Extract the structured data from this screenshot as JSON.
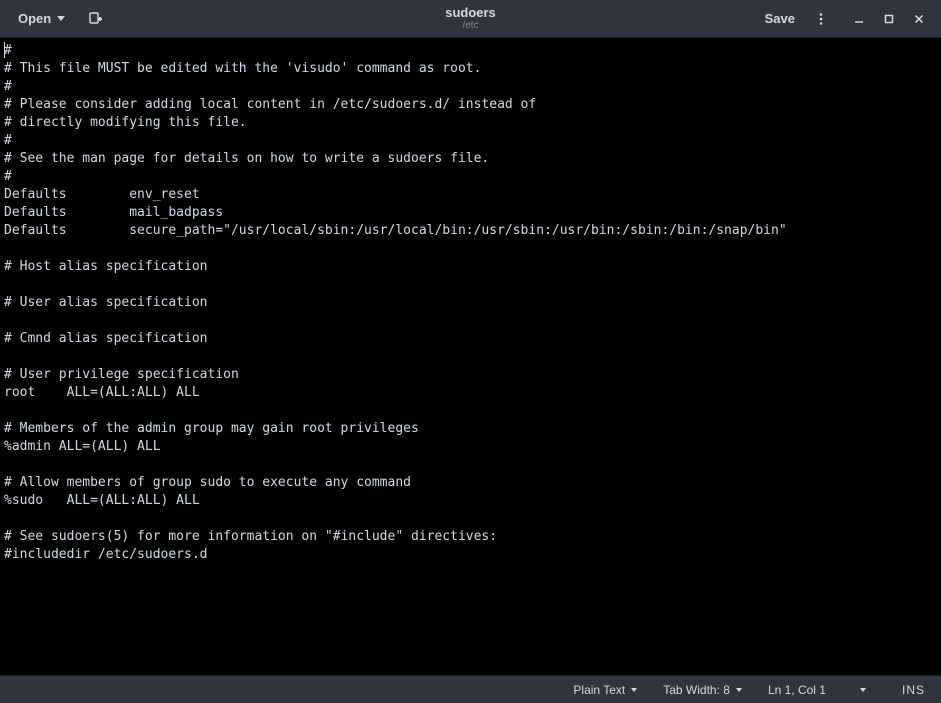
{
  "titlebar": {
    "open_label": "Open",
    "title": "sudoers",
    "subtitle": "/etc",
    "save_label": "Save"
  },
  "editor": {
    "content": "#\n# This file MUST be edited with the 'visudo' command as root.\n#\n# Please consider adding local content in /etc/sudoers.d/ instead of\n# directly modifying this file.\n#\n# See the man page for details on how to write a sudoers file.\n#\nDefaults        env_reset\nDefaults        mail_badpass\nDefaults        secure_path=\"/usr/local/sbin:/usr/local/bin:/usr/sbin:/usr/bin:/sbin:/bin:/snap/bin\"\n\n# Host alias specification\n\n# User alias specification\n\n# Cmnd alias specification\n\n# User privilege specification\nroot    ALL=(ALL:ALL) ALL\n\n# Members of the admin group may gain root privileges\n%admin ALL=(ALL) ALL\n\n# Allow members of group sudo to execute any command\n%sudo   ALL=(ALL:ALL) ALL\n\n# See sudoers(5) for more information on \"#include\" directives:\n#includedir /etc/sudoers.d"
  },
  "statusbar": {
    "syntax": "Plain Text",
    "tab_width": "Tab Width: 8",
    "position": "Ln 1, Col 1",
    "insert_mode": "INS"
  }
}
